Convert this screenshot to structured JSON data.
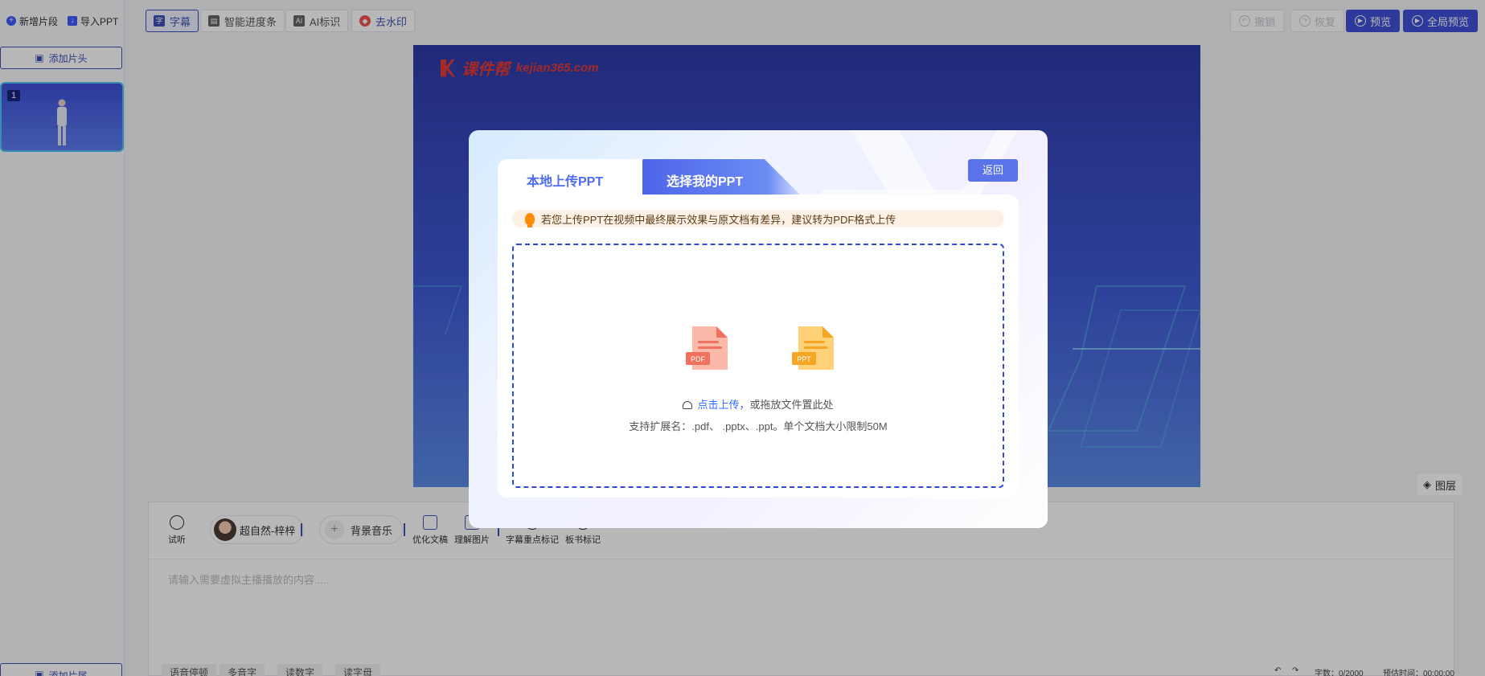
{
  "left_panel": {
    "new_segment_label": "新增片段",
    "import_ppt_label": "导入PPT",
    "add_head_label": "添加片头",
    "add_tail_label": "添加片尾",
    "thumbnail_number": "1"
  },
  "toolbar": {
    "subtitle_label": "字幕",
    "progress_label": "智能进度条",
    "ai_label": "AI标识",
    "watermark_label": "去水印",
    "undo_label": "撤销",
    "redo_label": "恢复",
    "preview_label": "预览",
    "full_preview_label": "全局预览"
  },
  "canvas": {
    "logo_cn": "课件帮",
    "logo_url": "kejian365.com",
    "layer_label": "图层"
  },
  "bottom": {
    "audition_label": "试听",
    "voice_name": "超自然-梓梓",
    "bgm_label": "背景音乐",
    "optimize_label": "优化文稿",
    "understand_label": "理解图片",
    "subtitle_mark_label": "字幕重点标记",
    "board_mark_label": "板书标记",
    "input_placeholder": "请输入需要虚拟主播播放的内容.....",
    "chips": [
      "语音停顿",
      "多音字",
      "读数字",
      "读字母"
    ],
    "word_count": "字数：0/2000",
    "duration": "预估时间：00:00:00"
  },
  "modal": {
    "tab_local": "本地上传PPT",
    "tab_mine": "选择我的PPT",
    "back_label": "返回",
    "notice": "若您上传PPT在视频中最终展示效果与原文档有差异，建议转为PDF格式上传",
    "pdf_icon_text": "PDF",
    "ppt_icon_text": "PPT",
    "click_upload": "点击上传，",
    "drag_text": "或拖放文件置此处",
    "support_text": "支持扩展名：.pdf、 .pptx、.ppt。单个文档大小限制50M"
  },
  "colors": {
    "accent": "#3f51d8",
    "link": "#2f6bff",
    "pdf": "#f0725e",
    "ppt": "#f5a623"
  }
}
